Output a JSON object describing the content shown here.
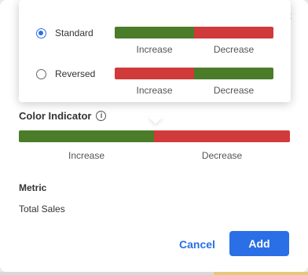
{
  "colors": {
    "increase": "#4a7c29",
    "decrease": "#d13a3a",
    "accent": "#2a6fe6"
  },
  "modal": {
    "close_icon": "close-icon",
    "close_glyph": "×",
    "color_indicator": {
      "title": "Color Indicator",
      "info_glyph": "i",
      "increase_label": "Increase",
      "decrease_label": "Decrease"
    },
    "metric": {
      "title": "Metric",
      "value": "Total Sales"
    },
    "buttons": {
      "cancel": "Cancel",
      "add": "Add"
    }
  },
  "popover": {
    "options": [
      {
        "label": "Standard",
        "selected": true,
        "left": "Increase",
        "right": "Decrease",
        "order": [
          "increase",
          "decrease"
        ]
      },
      {
        "label": "Reversed",
        "selected": false,
        "left": "Increase",
        "right": "Decrease",
        "order": [
          "decrease",
          "increase"
        ]
      }
    ]
  }
}
